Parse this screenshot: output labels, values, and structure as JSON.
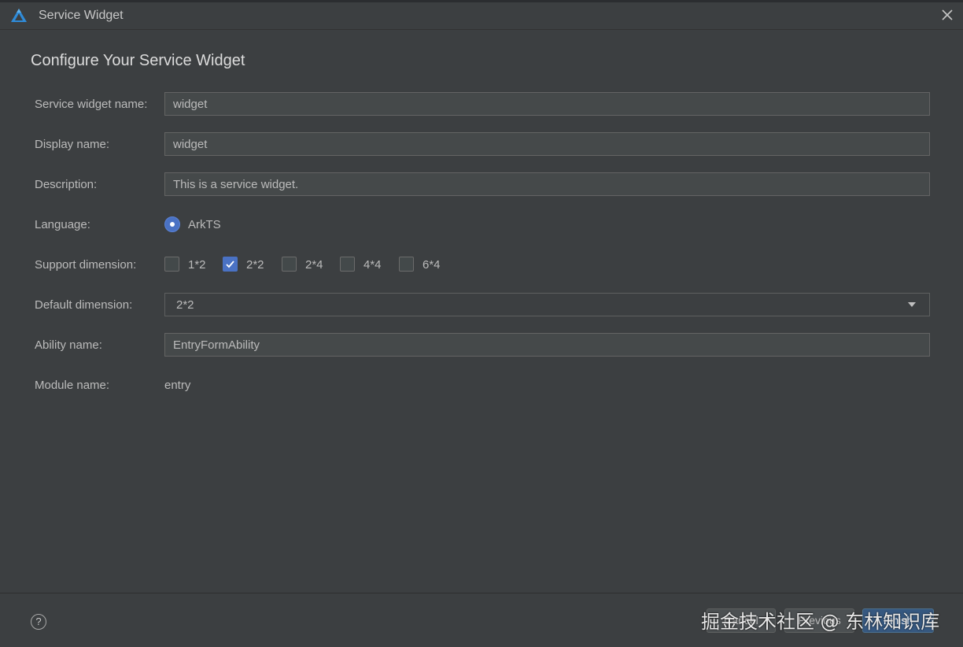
{
  "window": {
    "title": "Service Widget"
  },
  "heading": "Configure Your Service Widget",
  "form": {
    "service_widget_name": {
      "label": "Service widget name:",
      "value": "widget"
    },
    "display_name": {
      "label": "Display name:",
      "value": "widget"
    },
    "description": {
      "label": "Description:",
      "value": "This is a service widget."
    },
    "language": {
      "label": "Language:",
      "option": "ArkTS",
      "selected": true
    },
    "support_dimension": {
      "label": "Support dimension:",
      "options": [
        {
          "label": "1*2",
          "checked": false
        },
        {
          "label": "2*2",
          "checked": true
        },
        {
          "label": "2*4",
          "checked": false
        },
        {
          "label": "4*4",
          "checked": false
        },
        {
          "label": "6*4",
          "checked": false
        }
      ]
    },
    "default_dimension": {
      "label": "Default dimension:",
      "value": "2*2"
    },
    "ability_name": {
      "label": "Ability name:",
      "value": "EntryFormAbility"
    },
    "module_name": {
      "label": "Module name:",
      "value": "entry"
    }
  },
  "footer": {
    "help": "?",
    "buttons": [
      "Cancel",
      "Previous",
      "Finish"
    ]
  },
  "watermark": "掘金技术社区 @ 东林知识库",
  "colors": {
    "background": "#3c3f41",
    "field_background": "#45494a",
    "accent": "#4a72c4",
    "primary_button": "#365880"
  }
}
